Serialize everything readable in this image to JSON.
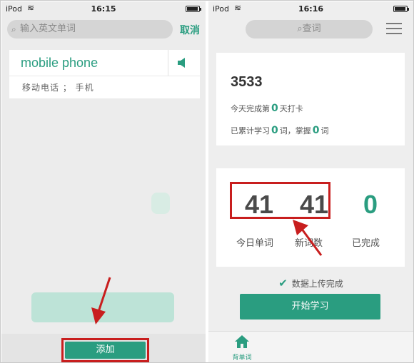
{
  "left": {
    "status": {
      "carrier": "iPod",
      "time": "16:15"
    },
    "search": {
      "placeholder": "输入英文单词"
    },
    "cancel_label": "取消",
    "word": {
      "text": "mobile phone",
      "meaning": "移动电话 ； 手机"
    },
    "add_label": "添加"
  },
  "right": {
    "status": {
      "carrier": "iPod",
      "time": "16:16"
    },
    "search": {
      "label": "查词"
    },
    "stats": {
      "total_words": "3533",
      "checkin_prefix": "今天完成第",
      "checkin_days": "0",
      "checkin_suffix": "天打卡",
      "learned_prefix": "已累计学习",
      "learned_count": "0",
      "learned_mid": "词，掌握",
      "mastered_count": "0",
      "learned_suffix": "词"
    },
    "counts": [
      {
        "value": "41",
        "label": "今日单词"
      },
      {
        "value": "41",
        "label": "新词数"
      },
      {
        "value": "0",
        "label": "已完成"
      }
    ],
    "upload_status": "数据上传完成",
    "start_label": "开始学习",
    "tab_home_label": "背单词"
  },
  "colors": {
    "accent": "#2a9d80",
    "highlight": "#c81e1e"
  },
  "icons": {
    "status": [
      "wifi-icon",
      "battery-icon"
    ],
    "left": [
      "search-icon",
      "speaker-icon"
    ],
    "right": [
      "search-icon",
      "menu-icon",
      "check-icon",
      "home-icon"
    ],
    "annotations": [
      "red-arrow-icon"
    ]
  }
}
